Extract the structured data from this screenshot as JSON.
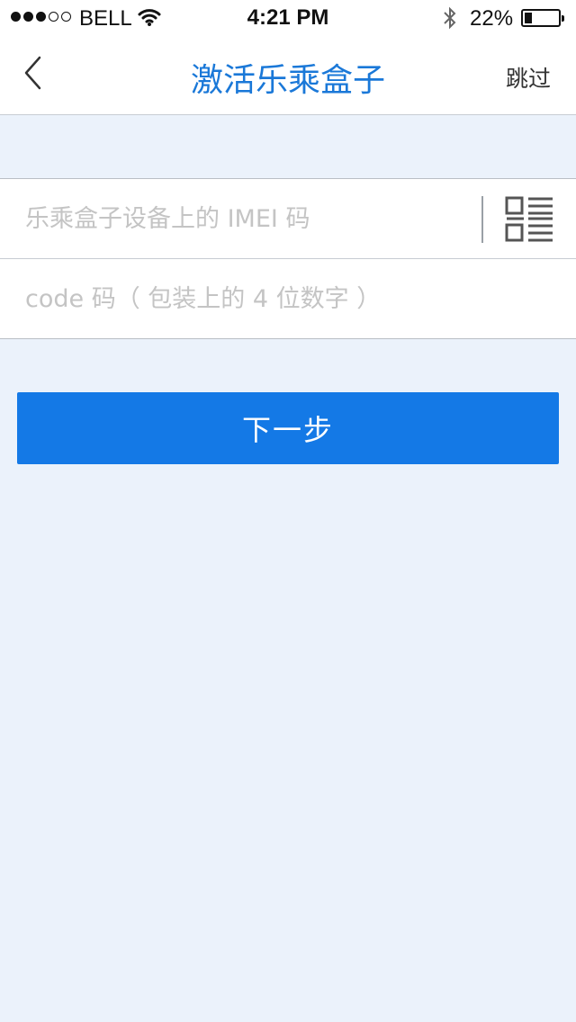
{
  "status_bar": {
    "carrier": "BELL",
    "time": "4:21 PM",
    "battery_percent": "22%",
    "battery_level": 0.22,
    "signal_bars_filled": 3,
    "signal_bars_total": 5,
    "icons": [
      "wifi-icon",
      "bluetooth-icon",
      "battery-icon"
    ]
  },
  "nav": {
    "title": "激活乐乘盒子",
    "skip_label": "跳过",
    "back_icon": "chevron-left-icon"
  },
  "form": {
    "imei_placeholder": "乐乘盒子设备上的 IMEI 码",
    "imei_value": "",
    "code_placeholder": "code 码（ 包装上的 4 位数字 ）",
    "code_value": "",
    "scan_icon": "qr-code-icon"
  },
  "actions": {
    "next_label": "下一步"
  },
  "colors": {
    "accent": "#1a78d8",
    "button": "#1479e6",
    "background": "#ebf2fb",
    "placeholder": "#c4c4c4"
  }
}
